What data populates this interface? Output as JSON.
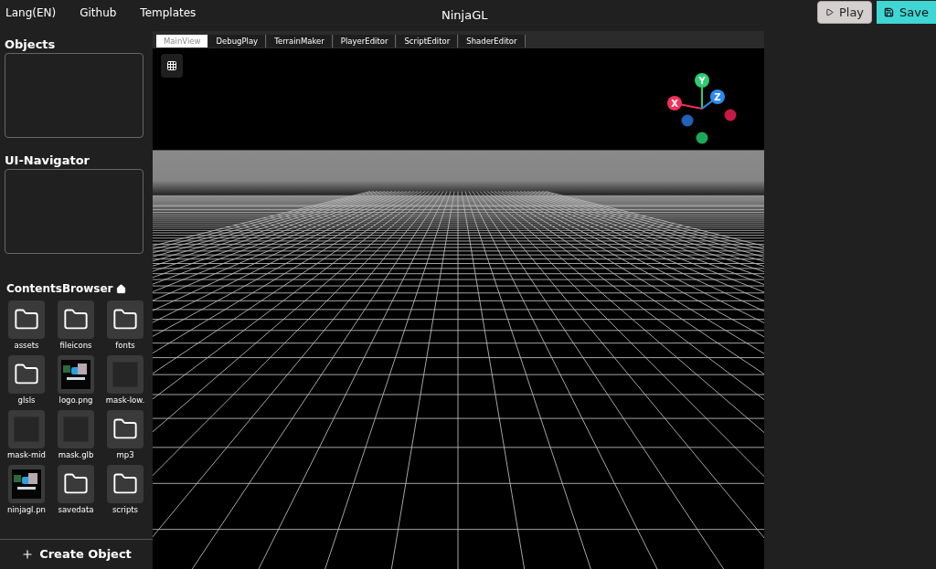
{
  "menu": [
    {
      "label": "Lang(EN)"
    },
    {
      "label": "Github"
    },
    {
      "label": "Templates"
    }
  ],
  "app_title": "NinjaGL",
  "actions": [
    {
      "kind": "play",
      "label": "Play"
    },
    {
      "kind": "save",
      "label": "Save"
    }
  ],
  "sidebar": {
    "objects_title": "Objects",
    "navigator_title": "UI-Navigator",
    "browser_title": "ContentsBrowser",
    "contents": [
      {
        "kind": "folder",
        "name": "assets"
      },
      {
        "kind": "folder",
        "name": "fileicons"
      },
      {
        "kind": "folder",
        "name": "fonts"
      },
      {
        "kind": "folder",
        "name": "glsls"
      },
      {
        "name": "logo.png"
      },
      {
        "kind": "blank",
        "name": "mask-low."
      },
      {
        "kind": "blank",
        "name": "mask-mid"
      },
      {
        "kind": "blank",
        "name": "mask.glb"
      },
      {
        "kind": "folder",
        "name": "mp3"
      },
      {
        "name": "ninjagl.pn"
      },
      {
        "kind": "folder",
        "name": "savedata"
      },
      {
        "kind": "folder",
        "name": "scripts"
      }
    ],
    "create_label": "Create Object"
  },
  "tabs": [
    {
      "label": "MainView",
      "selected": true
    },
    {
      "label": "DebugPlay",
      "selected": false
    },
    {
      "label": "TerrainMaker",
      "selected": false
    },
    {
      "label": "PlayerEditor",
      "selected": false
    },
    {
      "label": "ScriptEditor",
      "selected": false
    },
    {
      "label": "ShaderEditor",
      "selected": false
    }
  ],
  "gizmo": {
    "x": "X",
    "y": "Y",
    "z": "Z"
  }
}
